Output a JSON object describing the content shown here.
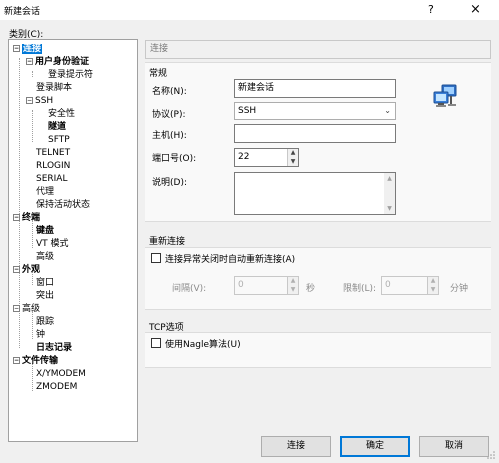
{
  "window": {
    "title": "新建会话",
    "help_label": "?",
    "close_label": "×"
  },
  "category_label": "类别(C):",
  "tree": {
    "items": [
      {
        "label": "连接",
        "toggle": "−"
      },
      {
        "label": "用户身份验证",
        "toggle": "−"
      },
      {
        "label": "登录提示符"
      },
      {
        "label": "登录脚本"
      },
      {
        "label": "SSH",
        "toggle": "−"
      },
      {
        "label": "安全性"
      },
      {
        "label": "隧道"
      },
      {
        "label": "SFTP"
      },
      {
        "label": "TELNET"
      },
      {
        "label": "RLOGIN"
      },
      {
        "label": "SERIAL"
      },
      {
        "label": "代理"
      },
      {
        "label": "保持活动状态"
      },
      {
        "label": "终端",
        "toggle": "−"
      },
      {
        "label": "键盘"
      },
      {
        "label": "VT 模式"
      },
      {
        "label": "高级"
      },
      {
        "label": "外观",
        "toggle": "−"
      },
      {
        "label": "窗口"
      },
      {
        "label": "突出"
      },
      {
        "label": "高级",
        "toggle": "−"
      },
      {
        "label": "跟踪"
      },
      {
        "label": "钟"
      },
      {
        "label": "日志记录"
      },
      {
        "label": "文件传输",
        "toggle": "−"
      },
      {
        "label": "X/YMODEM"
      },
      {
        "label": "ZMODEM"
      }
    ]
  },
  "breadcrumb": "连接",
  "general": {
    "title": "常规",
    "name_label": "名称(N):",
    "name_value": "新建会话",
    "protocol_label": "协议(P):",
    "protocol_value": "SSH",
    "host_label": "主机(H):",
    "host_value": "",
    "port_label": "端口号(O):",
    "port_value": "22",
    "description_label": "说明(D):",
    "description_value": ""
  },
  "reconnect": {
    "title": "重新连接",
    "auto_label": "连接异常关闭时自动重新连接(A)",
    "interval_label": "间隔(V):",
    "interval_value": "0",
    "interval_unit": "秒",
    "limit_label": "限制(L):",
    "limit_value": "0",
    "limit_unit": "分钟"
  },
  "tcp": {
    "title": "TCP选项",
    "nagle_label": "使用Nagle算法(U)"
  },
  "buttons": {
    "connect": "连接",
    "ok": "确定",
    "cancel": "取消"
  },
  "colors": {
    "selection": "#0078d7",
    "default_button_border": "#0078d7"
  },
  "icons": {
    "session_icon": "network-computers-icon"
  }
}
